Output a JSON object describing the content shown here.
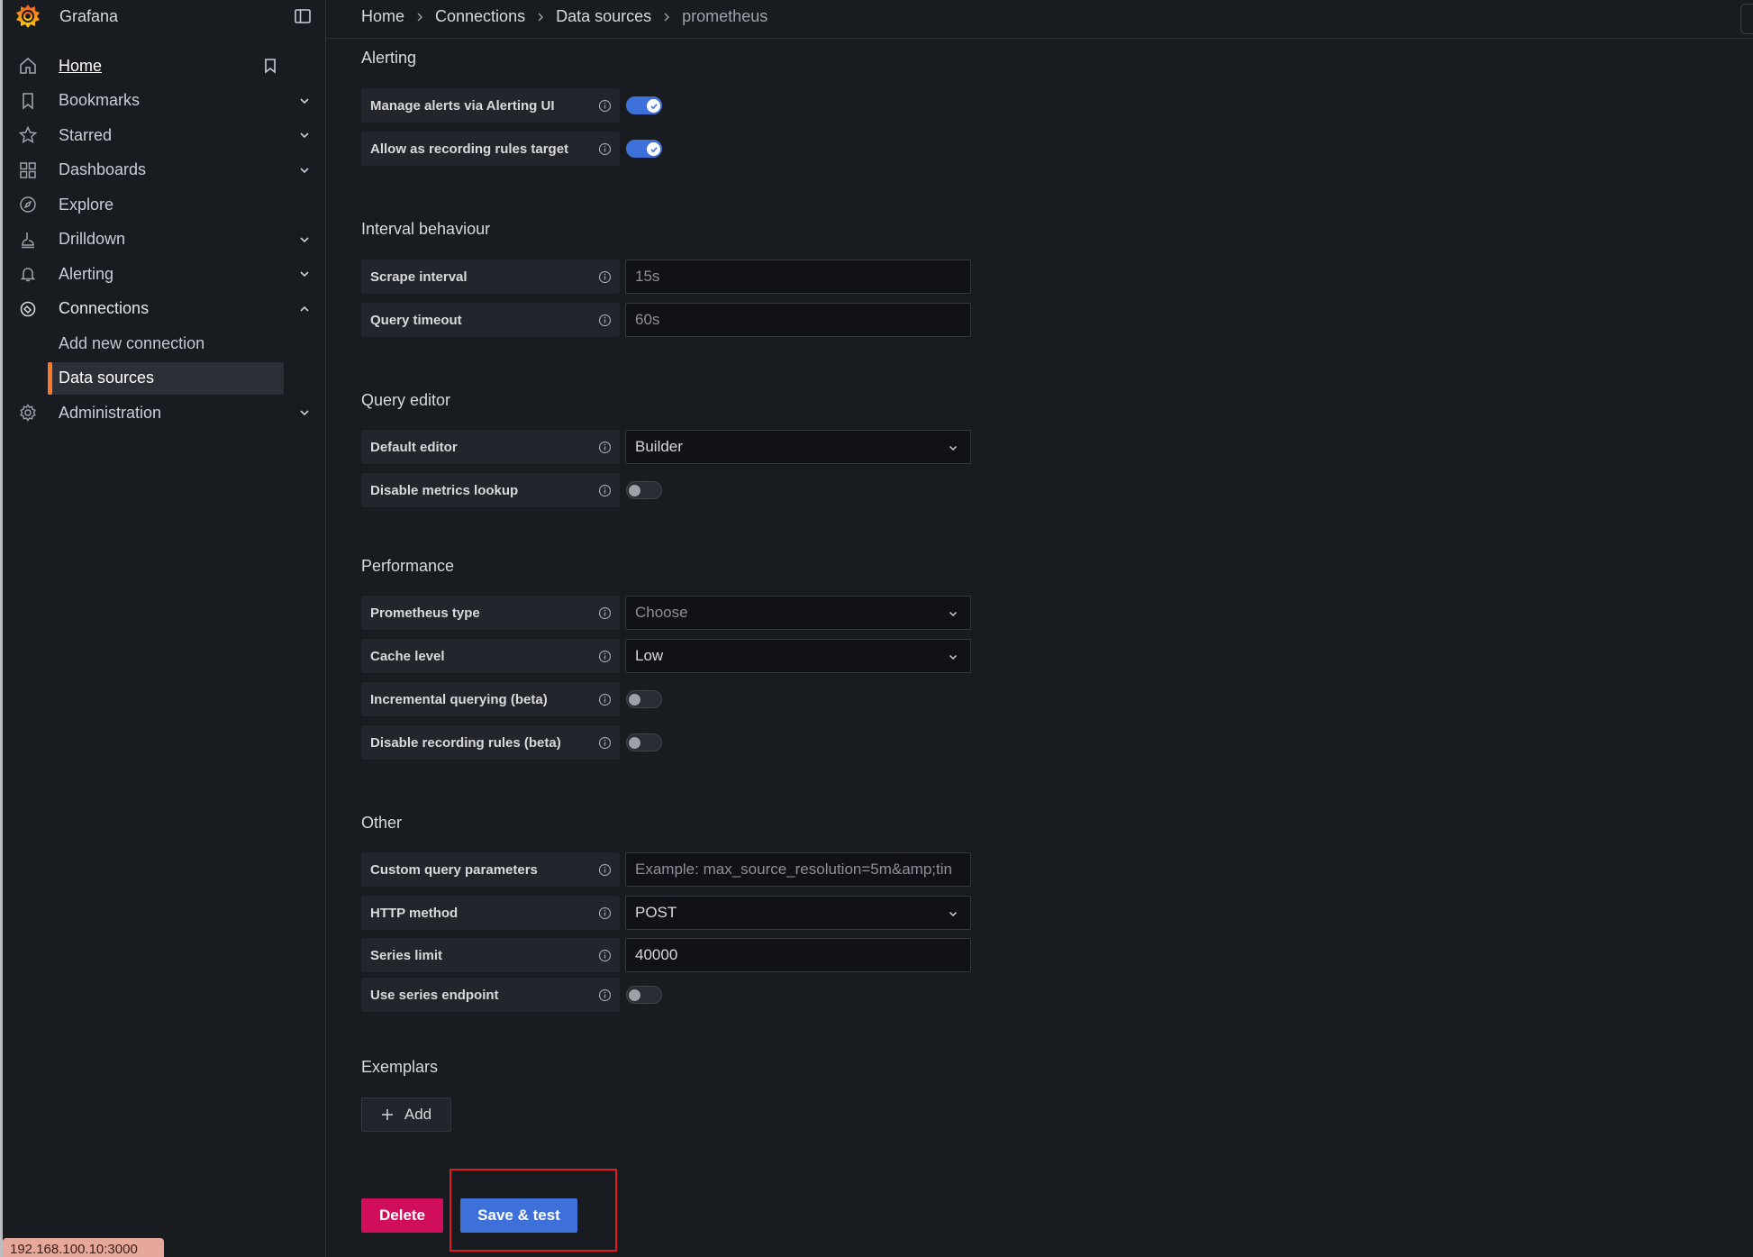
{
  "app": {
    "name": "Grafana"
  },
  "nav": {
    "items": [
      {
        "label": "Home"
      },
      {
        "label": "Bookmarks"
      },
      {
        "label": "Starred"
      },
      {
        "label": "Dashboards"
      },
      {
        "label": "Explore"
      },
      {
        "label": "Drilldown"
      },
      {
        "label": "Alerting"
      },
      {
        "label": "Connections"
      },
      {
        "label": "Add new connection"
      },
      {
        "label": "Data sources"
      },
      {
        "label": "Administration"
      }
    ]
  },
  "breadcrumbs": [
    "Home",
    "Connections",
    "Data sources",
    "prometheus"
  ],
  "sections": {
    "alerting": {
      "title": "Alerting",
      "manage_alerts": {
        "label": "Manage alerts via Alerting UI",
        "enabled": true
      },
      "recording_rules_target": {
        "label": "Allow as recording rules target",
        "enabled": true
      }
    },
    "interval": {
      "title": "Interval behaviour",
      "scrape_interval": {
        "label": "Scrape interval",
        "placeholder": "15s"
      },
      "query_timeout": {
        "label": "Query timeout",
        "placeholder": "60s"
      }
    },
    "query_editor": {
      "title": "Query editor",
      "default_editor": {
        "label": "Default editor",
        "value": "Builder"
      },
      "disable_metrics_lookup": {
        "label": "Disable metrics lookup",
        "enabled": false
      }
    },
    "performance": {
      "title": "Performance",
      "prometheus_type": {
        "label": "Prometheus type",
        "placeholder": "Choose"
      },
      "cache_level": {
        "label": "Cache level",
        "value": "Low"
      },
      "incremental_querying": {
        "label": "Incremental querying (beta)",
        "enabled": false
      },
      "disable_recording_rules": {
        "label": "Disable recording rules (beta)",
        "enabled": false
      }
    },
    "other": {
      "title": "Other",
      "custom_query_params": {
        "label": "Custom query parameters",
        "placeholder": "Example: max_source_resolution=5m&amp;tin"
      },
      "http_method": {
        "label": "HTTP method",
        "value": "POST"
      },
      "series_limit": {
        "label": "Series limit",
        "value": "40000"
      },
      "use_series_endpoint": {
        "label": "Use series endpoint",
        "enabled": false
      }
    },
    "exemplars": {
      "title": "Exemplars",
      "add_label": "Add"
    }
  },
  "actions": {
    "delete_label": "Delete",
    "save_label": "Save & test"
  },
  "status_bar": {
    "url": "192.168.100.10:3000"
  },
  "colors": {
    "accent": "#3d71d9",
    "danger": "#d10e5c",
    "brand": "#f57a2e",
    "highlight": "#e01b24"
  }
}
